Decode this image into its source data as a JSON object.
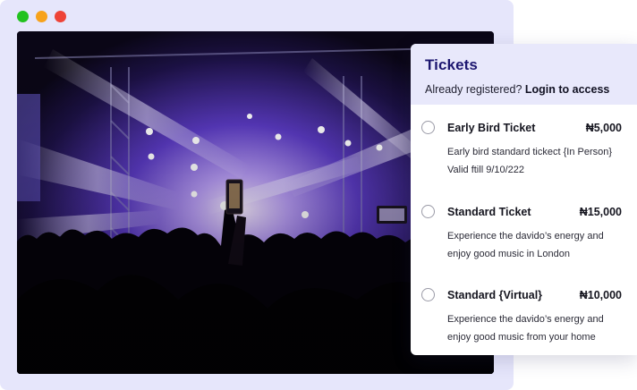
{
  "window": {
    "controls": [
      {
        "name": "close",
        "color": "#22c21f"
      },
      {
        "name": "minimize",
        "color": "#f7a21b"
      },
      {
        "name": "maximize",
        "color": "#ee4337"
      }
    ]
  },
  "hero": {
    "image": "concert-crowd-photo"
  },
  "tickets_panel": {
    "title": "Tickets",
    "login_prompt": "Already registered?",
    "login_link": "Login to access",
    "items": [
      {
        "name": "Early Bird Ticket",
        "price": "₦5,000",
        "desc_line1": "Early bird standard tickect {In Person}",
        "desc_line2": "Valid ftill 9/10/222"
      },
      {
        "name": "Standard Ticket",
        "price": "₦15,000",
        "desc_line1": "Experience the davido’s  energy and",
        "desc_line2": "enjoy good music in London"
      },
      {
        "name": "Standard {Virtual}",
        "price": "₦10,000",
        "desc_line1": "Experience the davido’s  energy and",
        "desc_line2": "enjoy good music from your home"
      }
    ]
  },
  "colors": {
    "window_bg": "#e6e6fb",
    "panel_header_bg": "#e8e8fb",
    "title_color": "#1d1770"
  }
}
